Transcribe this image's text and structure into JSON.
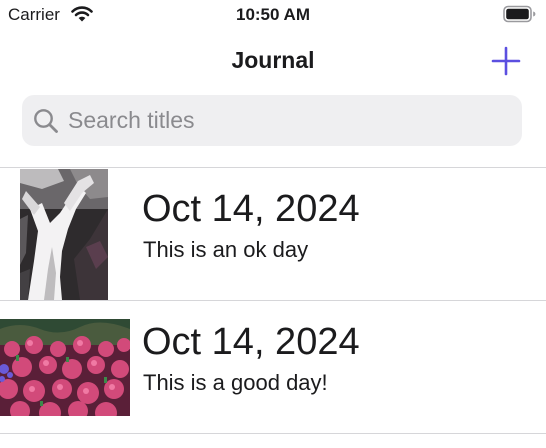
{
  "status_bar": {
    "carrier": "Carrier",
    "time": "10:50 AM"
  },
  "nav": {
    "title": "Journal",
    "add_icon": "plus-icon"
  },
  "search": {
    "placeholder": "Search titles",
    "value": "",
    "icon": "magnifier-icon"
  },
  "colors": {
    "accent": "#5b4fe0",
    "search_background": "#efeff1",
    "separator": "#d6d6d9"
  },
  "entries": [
    {
      "date": "Oct 14, 2024",
      "title": "This is an ok day",
      "photo": "black-and-white-tree-photo"
    },
    {
      "date": "Oct 14, 2024",
      "title": "This is a good day!",
      "photo": "pink-flower-field-photo"
    }
  ]
}
